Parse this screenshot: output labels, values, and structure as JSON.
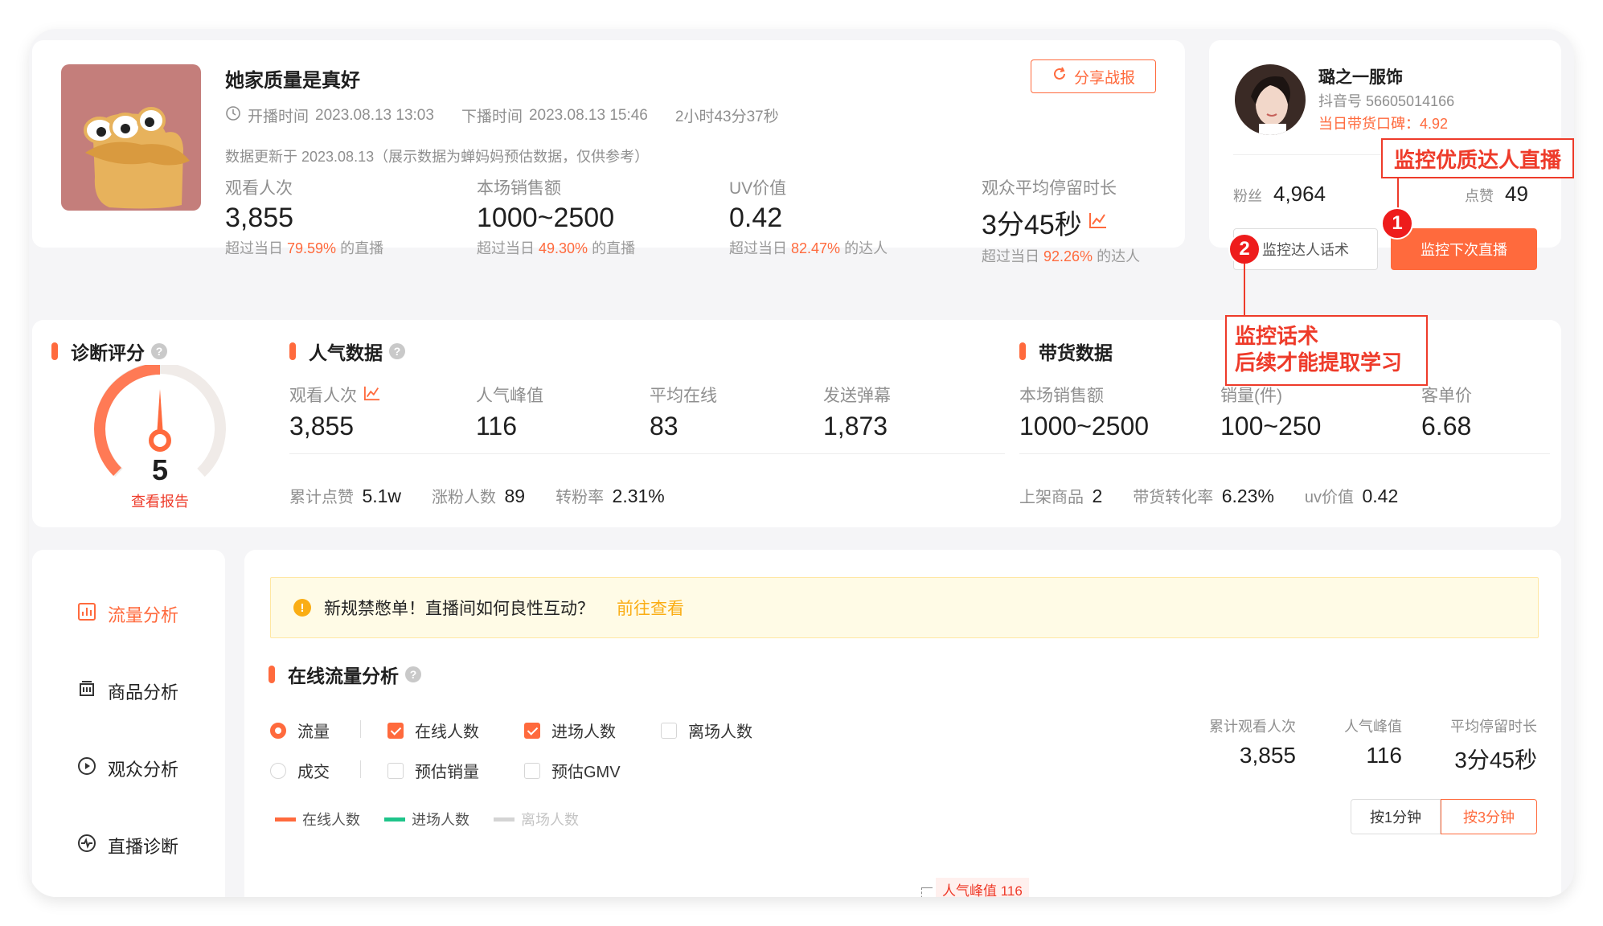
{
  "header": {
    "title": "她家质量是真好",
    "share_label": "分享战报",
    "start_label": "开播时间",
    "start_time": "2023.08.13 13:03",
    "end_label": "下播时间",
    "end_time": "2023.08.13 15:46",
    "duration": "2小时43分37秒",
    "update_note": "数据更新于 2023.08.13（展示数据为蝉妈妈预估数据，仅供参考）",
    "stats": [
      {
        "label": "观看人次",
        "value": "3,855",
        "prefix": "超过当日",
        "pct": "79.59%",
        "suffix": "的直播"
      },
      {
        "label": "本场销售额",
        "value": "1000~2500",
        "prefix": "超过当日",
        "pct": "49.30%",
        "suffix": "的直播"
      },
      {
        "label": "UV价值",
        "value": "0.42",
        "prefix": "超过当日",
        "pct": "82.47%",
        "suffix": "的达人"
      },
      {
        "label": "观众平均停留时长",
        "value": "3分45秒",
        "prefix": "超过当日",
        "pct": "92.26%",
        "suffix": "的达人"
      }
    ]
  },
  "profile": {
    "name": "璐之一服饰",
    "douyin_id": "抖音号 56605014166",
    "reputation": "当日带货口碑：4.92",
    "fans_label": "粉丝",
    "fans": "4,964",
    "likes_label": "点赞",
    "likes": "49",
    "monitor_script_btn": "监控达人话术",
    "monitor_next_btn": "监控下次直播"
  },
  "annotations": {
    "a1": "监控优质达人直播",
    "a2_line1": "监控话术",
    "a2_line2": "后续才能提取学习",
    "num1": "1",
    "num2": "2"
  },
  "diagnosis": {
    "title": "诊断评分",
    "score": "5",
    "score_value": 5,
    "score_max": 10,
    "report_link": "查看报告"
  },
  "popularity": {
    "title": "人气数据",
    "metrics": [
      {
        "label": "观看人次",
        "value": "3,855"
      },
      {
        "label": "人气峰值",
        "value": "116"
      },
      {
        "label": "平均在线",
        "value": "83"
      },
      {
        "label": "发送弹幕",
        "value": "1,873"
      }
    ],
    "extra": [
      {
        "label": "累计点赞",
        "value": "5.1w"
      },
      {
        "label": "涨粉人数",
        "value": "89"
      },
      {
        "label": "转粉率",
        "value": "2.31%"
      }
    ]
  },
  "sales": {
    "title": "带货数据",
    "metrics": [
      {
        "label": "本场销售额",
        "value": "1000~2500"
      },
      {
        "label": "销量(件)",
        "value": "100~250"
      },
      {
        "label": "客单价",
        "value": "6.68"
      }
    ],
    "extra": [
      {
        "label": "上架商品",
        "value": "2"
      },
      {
        "label": "带货转化率",
        "value": "6.23%"
      },
      {
        "label": "uv价值",
        "value": "0.42"
      }
    ]
  },
  "sidebar": {
    "items": [
      {
        "label": "流量分析",
        "icon": "chart-icon",
        "active": true
      },
      {
        "label": "商品分析",
        "icon": "shop-icon",
        "active": false
      },
      {
        "label": "观众分析",
        "icon": "play-circle-icon",
        "active": false
      },
      {
        "label": "直播诊断",
        "icon": "pulse-icon",
        "active": false
      }
    ]
  },
  "notice": {
    "text": "新规禁憋单！直播间如何良性互动？",
    "link": "前往查看"
  },
  "traffic": {
    "title": "在线流量分析",
    "options_row1": [
      {
        "label": "流量",
        "type": "radio",
        "checked": true
      },
      {
        "label": "在线人数",
        "type": "checkbox",
        "checked": true
      },
      {
        "label": "进场人数",
        "type": "checkbox",
        "checked": true
      },
      {
        "label": "离场人数",
        "type": "checkbox",
        "checked": false
      }
    ],
    "options_row2": [
      {
        "label": "成交",
        "type": "radio",
        "checked": false
      },
      {
        "label": "预估销量",
        "type": "checkbox",
        "checked": false
      },
      {
        "label": "预估GMV",
        "type": "checkbox",
        "checked": false
      }
    ],
    "summary": [
      {
        "label": "累计观看人次",
        "value": "3,855"
      },
      {
        "label": "人气峰值",
        "value": "116"
      },
      {
        "label": "平均停留时长",
        "value": "3分45秒"
      }
    ],
    "legend": [
      {
        "label": "在线人数",
        "color": "#ff6a3d"
      },
      {
        "label": "进场人数",
        "color": "#1fc48a"
      },
      {
        "label": "离场人数",
        "color": "#d4d4d4"
      }
    ],
    "interval_buttons": [
      "按1分钟",
      "按3分钟"
    ],
    "chart_y_tick": "175",
    "peak_label": "人气峰值 116"
  },
  "colors": {
    "accent": "#ff6a3d",
    "annotation_red": "#ee3b2a"
  }
}
